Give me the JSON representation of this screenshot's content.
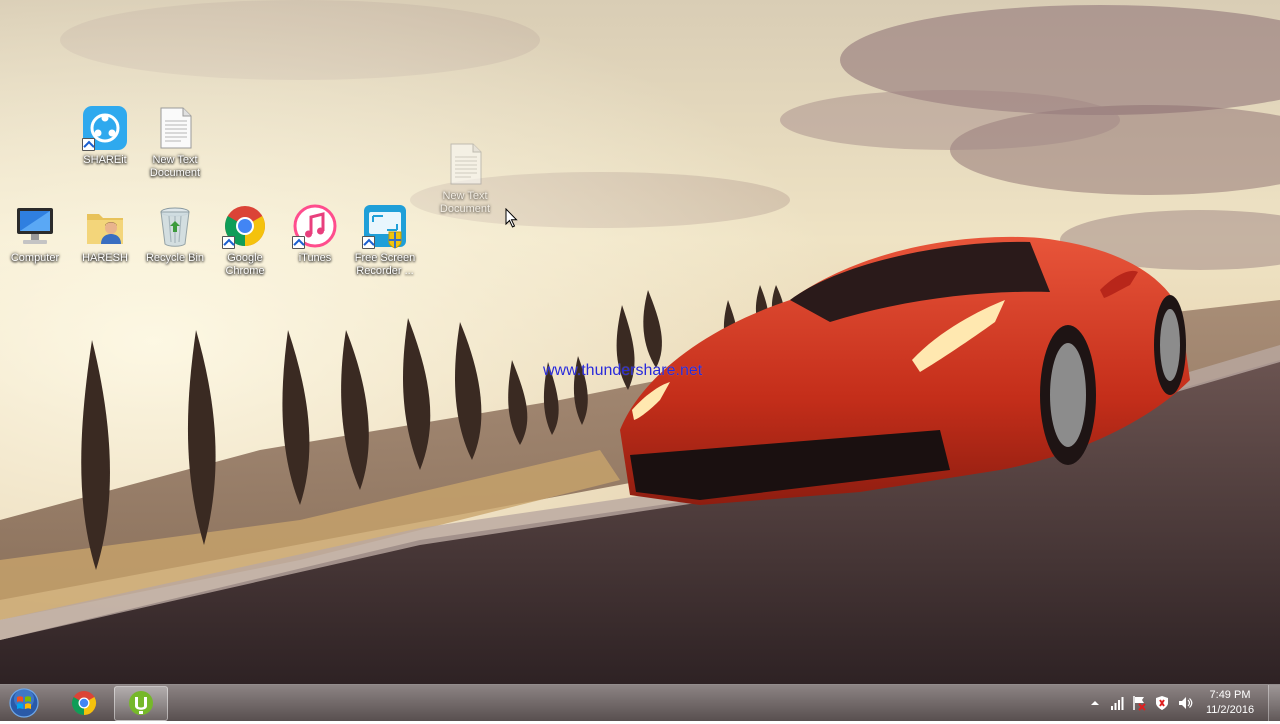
{
  "desktop": {
    "watermark": "www.thundershare.net",
    "icons": [
      {
        "label": "SHAREit",
        "icon": "shareit-icon"
      },
      {
        "label": "New Text\nDocument",
        "icon": "text-document-icon"
      },
      {
        "label": "New Text\nDocument",
        "icon": "text-document-icon"
      },
      {
        "label": "Computer",
        "icon": "computer-icon"
      },
      {
        "label": "HARESH",
        "icon": "user-folder-icon"
      },
      {
        "label": "Recycle Bin",
        "icon": "recycle-bin-icon"
      },
      {
        "label": "Google\nChrome",
        "icon": "chrome-icon"
      },
      {
        "label": "iTunes",
        "icon": "itunes-icon"
      },
      {
        "label": "Free Screen\nRecorder ...",
        "icon": "screen-recorder-icon"
      }
    ]
  },
  "taskbar": {
    "start_button": "start-orb-icon",
    "pinned": [
      {
        "app": "Google Chrome",
        "icon": "chrome-icon",
        "active": false
      },
      {
        "app": "uTorrent",
        "icon": "utorrent-icon",
        "active": true
      }
    ],
    "tray_icons": [
      "show-hidden-icons-arrow",
      "network-signal-icon",
      "action-center-flag-icon",
      "security-shield-icon",
      "volume-icon"
    ],
    "clock": {
      "time": "7:49 PM",
      "date": "11/2/2016"
    }
  },
  "colors": {
    "watermark": "#2a2ad8",
    "car": "#c8301c",
    "sky": "#efe3c4"
  }
}
